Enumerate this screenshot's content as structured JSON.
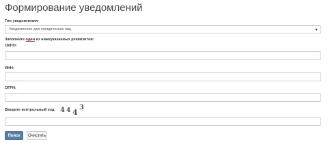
{
  "header": {
    "title": "Формирование уведомлений"
  },
  "form": {
    "notification_type": {
      "label": "Тип уведомления:",
      "selected": "Уведомление для юридических лиц"
    },
    "hint": {
      "prefix": "Заполните ",
      "emphasis": "один",
      "suffix": " из нижеуказанных реквизитов:"
    },
    "okpo": {
      "label": "ОКПО:",
      "value": ""
    },
    "inn": {
      "label": "ИНН:",
      "value": ""
    },
    "ogrn": {
      "label": "ОГРН:",
      "value": ""
    },
    "captcha": {
      "label": "Введите контрольный код:",
      "code": "4443",
      "value": ""
    }
  },
  "buttons": {
    "search_label": "Поиск",
    "clear_label": "Очистить"
  },
  "colors": {
    "primary_button": "#587ea3",
    "hint_underline": "#c9302c"
  },
  "icons": {
    "select_caret": "caret-down-icon"
  }
}
